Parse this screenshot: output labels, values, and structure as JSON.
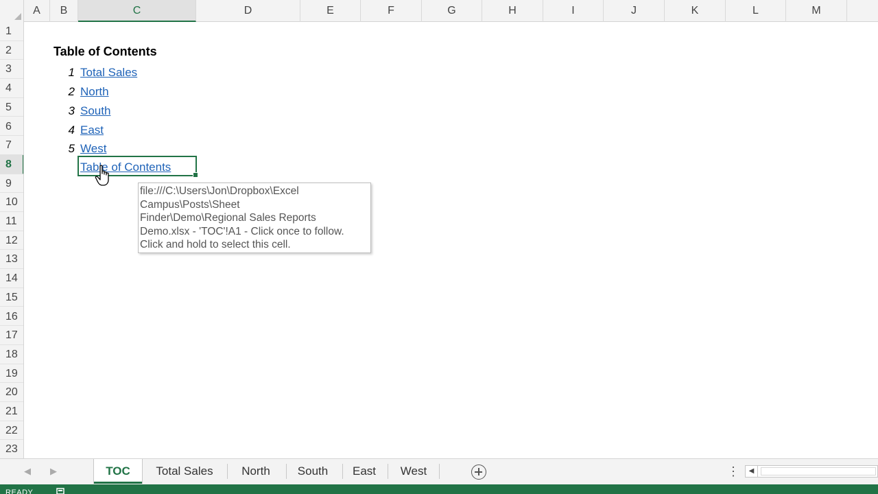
{
  "columns": [
    "A",
    "B",
    "C",
    "D",
    "E",
    "F",
    "G",
    "H",
    "I",
    "J",
    "K",
    "L",
    "M"
  ],
  "active_column": "C",
  "rows": [
    "1",
    "2",
    "3",
    "4",
    "5",
    "6",
    "7",
    "8",
    "9",
    "10",
    "11",
    "12",
    "13",
    "14",
    "15",
    "16",
    "17",
    "18",
    "19",
    "20",
    "21",
    "22",
    "23"
  ],
  "active_row": "8",
  "sheet": {
    "title": "Table of Contents",
    "items": [
      {
        "num": "1",
        "label": "Total Sales"
      },
      {
        "num": "2",
        "label": "North"
      },
      {
        "num": "3",
        "label": "South"
      },
      {
        "num": "4",
        "label": "East"
      },
      {
        "num": "5",
        "label": "West"
      }
    ],
    "selected_link": "Table of Contents"
  },
  "tooltip": {
    "lines": [
      "file:///C:\\Users\\Jon\\Dropbox\\Excel",
      "Campus\\Posts\\Sheet",
      "Finder\\Demo\\Regional Sales Reports",
      "Demo.xlsx - 'TOC'!A1 - Click once to follow.",
      "Click and hold to select this cell."
    ]
  },
  "tabs": [
    {
      "label": "TOC",
      "active": true
    },
    {
      "label": "Total Sales",
      "active": false
    },
    {
      "label": "North",
      "active": false
    },
    {
      "label": "South",
      "active": false
    },
    {
      "label": "East",
      "active": false
    },
    {
      "label": "West",
      "active": false
    }
  ],
  "status": {
    "text": "READY"
  },
  "colors": {
    "accent": "#217346",
    "link": "#1f63b8"
  }
}
